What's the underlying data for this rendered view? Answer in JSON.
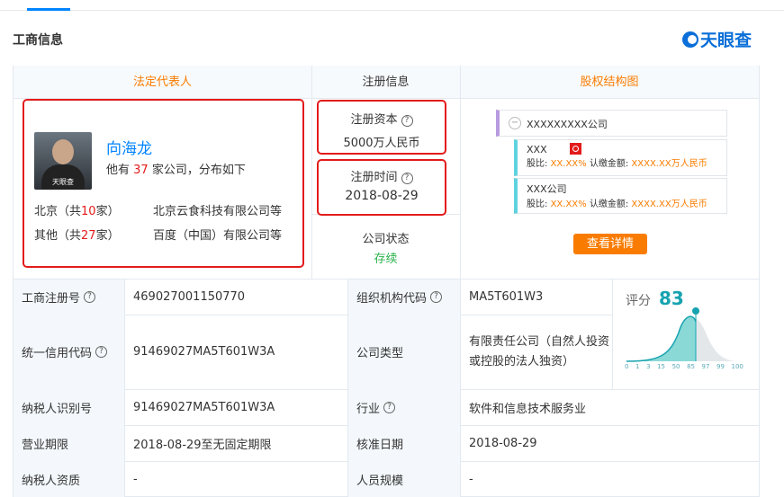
{
  "section_title": "工商信息",
  "logo_text": "天眼查",
  "headers": {
    "legal": "法定代表人",
    "reg": "注册信息",
    "equity": "股权结构图"
  },
  "legal": {
    "name": "向海龙",
    "summary_prefix": "他有",
    "company_count": "37",
    "summary_suffix": "家公司，分布如下",
    "regions": [
      {
        "prefix": "北京（共",
        "count": "10",
        "suffix": "家）",
        "company": "北京云食科技有限公司等"
      },
      {
        "prefix": "其他（共",
        "count": "27",
        "suffix": "家）",
        "company": "百度（中国）有限公司等"
      }
    ],
    "avatar_watermark": "天眼查"
  },
  "reg": {
    "capital_label": "注册资本",
    "capital": "5000万人民币",
    "date_label": "注册时间",
    "date": "2018-08-29",
    "status_label": "公司状态",
    "status": "存续"
  },
  "equity": {
    "root": "XXXXXXXXX公司",
    "nodes": [
      {
        "name": "XXX",
        "ratio_label": "股比:",
        "ratio": "XX.XX%",
        "amount_label": "认缴金额:",
        "amount": "XXXX.XX万人民币"
      },
      {
        "name": "XXX公司",
        "ratio_label": "股比:",
        "ratio": "XX.XX%",
        "amount_label": "认缴金额:",
        "amount": "XXXX.XX万人民币"
      }
    ],
    "detail_button": "查看详情"
  },
  "score": {
    "label": "评分",
    "value": "83",
    "ticks": [
      "0",
      "1",
      "3",
      "15",
      "50",
      "85",
      "97",
      "99",
      "100"
    ]
  },
  "rows": [
    {
      "l1": "工商注册号",
      "v1": "469027001150770",
      "l2": "组织机构代码",
      "v2": "MA5T601W3"
    },
    {
      "l1": "统一信用代码",
      "v1": "91469027MA5T601W3A",
      "l2": "公司类型",
      "v2": "有限责任公司（自然人投资或控股的法人独资）"
    },
    {
      "l1": "纳税人识别号",
      "v1": "91469027MA5T601W3A",
      "l2": "行业",
      "v2": "软件和信息技术服务业"
    },
    {
      "l1": "营业期限",
      "v1": "2018-08-29至无固定期限",
      "l2": "核准日期",
      "v2": "2018-08-29"
    },
    {
      "l1": "纳税人资质",
      "v1": "-",
      "l2": "人员规模",
      "v2": "-"
    }
  ],
  "colors": {
    "accent": "#0084ff",
    "orange": "#f97c00",
    "red": "#e31b1b",
    "teal": "#16a3b0"
  }
}
